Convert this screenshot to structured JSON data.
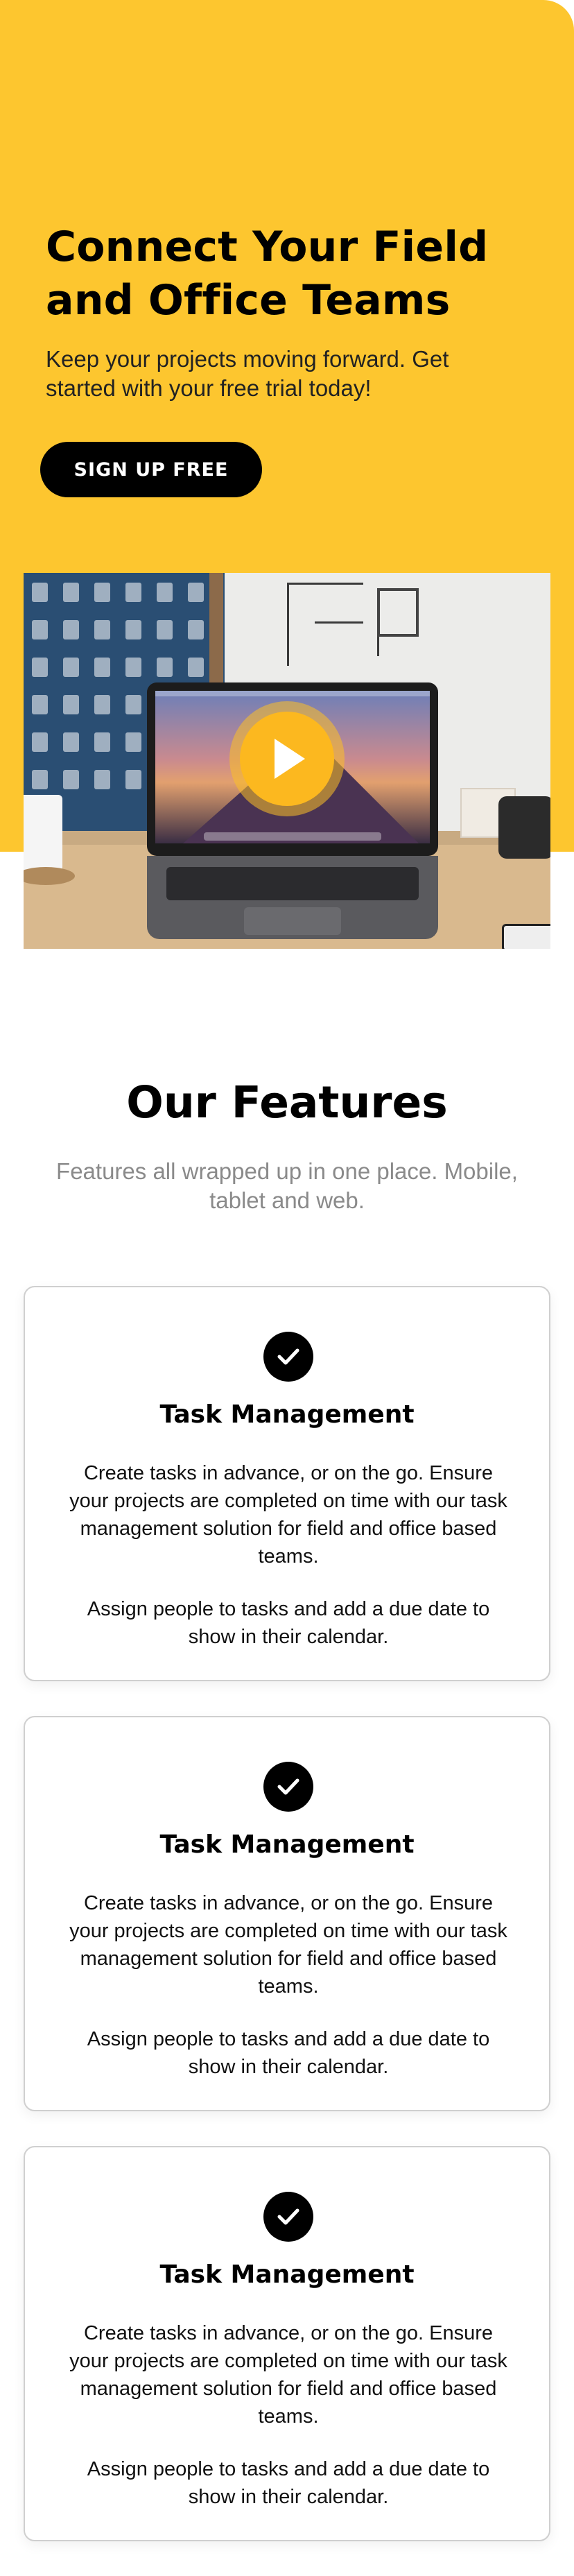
{
  "hero": {
    "title": "Connect Your Field and Office Teams",
    "subtitle": "Keep your projects moving forward. Get started with your free trial today!",
    "cta_label": "SIGN UP FREE",
    "background_color": "#fdc62f"
  },
  "video": {
    "play_icon": "play-icon",
    "accent_color": "#fcb81f"
  },
  "features": {
    "title": "Our Features",
    "subtitle": "Features all wrapped up in one place. Mobile, tablet and web.",
    "cards": [
      {
        "icon": "checkmark-icon",
        "title": "Task Management",
        "paragraph_1": "Create tasks in advance, or on the go. Ensure your projects are completed on time with our task management solution for field and office based teams.",
        "paragraph_2": "Assign people to tasks and add a due date to show in their calendar."
      },
      {
        "icon": "checkmark-icon",
        "title": "Task Management",
        "paragraph_1": "Create tasks in advance, or on the go. Ensure your projects are completed on time with our task management solution for field and office based teams.",
        "paragraph_2": "Assign people to tasks and add a due date to show in their calendar."
      },
      {
        "icon": "checkmark-icon",
        "title": "Task Management",
        "paragraph_1": "Create tasks in advance, or on the go. Ensure your projects are completed on time with our task management solution for field and office based teams.",
        "paragraph_2": "Assign people to tasks and add a due date to show in their calendar."
      }
    ]
  }
}
